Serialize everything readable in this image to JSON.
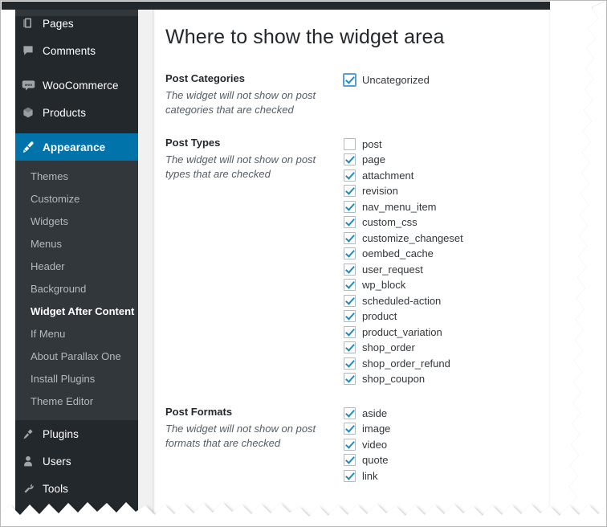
{
  "app": {
    "admin_bar_color": "#23282d",
    "accent_color": "#0073aa",
    "submenu_bg": "#32373c",
    "checkbox_check_color": "#1e8cbe"
  },
  "sidebar": {
    "items": [
      {
        "label": "Pages",
        "icon": "pages-icon",
        "current": false
      },
      {
        "label": "Comments",
        "icon": "comments-icon",
        "current": false
      },
      {
        "label": "WooCommerce",
        "icon": "woocommerce-icon",
        "current": false
      },
      {
        "label": "Products",
        "icon": "products-icon",
        "current": false
      },
      {
        "label": "Appearance",
        "icon": "appearance-brush-icon",
        "current": true
      }
    ],
    "submenu": [
      {
        "label": "Themes",
        "active": false
      },
      {
        "label": "Customize",
        "active": false
      },
      {
        "label": "Widgets",
        "active": false
      },
      {
        "label": "Menus",
        "active": false
      },
      {
        "label": "Header",
        "active": false
      },
      {
        "label": "Background",
        "active": false
      },
      {
        "label": "Widget After Content",
        "active": true
      },
      {
        "label": "If Menu",
        "active": false
      },
      {
        "label": "About Parallax One",
        "active": false
      },
      {
        "label": "Install Plugins",
        "active": false
      },
      {
        "label": "Theme Editor",
        "active": false
      }
    ],
    "lower_items": [
      {
        "label": "Plugins",
        "icon": "plugins-plug-icon"
      },
      {
        "label": "Users",
        "icon": "users-person-icon"
      },
      {
        "label": "Tools",
        "icon": "tools-wrench-icon"
      }
    ]
  },
  "main": {
    "title": "Where to show the widget area",
    "sections": [
      {
        "title": "Post Categories",
        "hint": "The widget will not show on post categories that are checked",
        "options": [
          {
            "label": "Uncategorized",
            "checked": true,
            "focused": true
          }
        ]
      },
      {
        "title": "Post Types",
        "hint": "The widget will not show on post types that are checked",
        "options": [
          {
            "label": "post",
            "checked": false,
            "focused": false
          },
          {
            "label": "page",
            "checked": true,
            "focused": false
          },
          {
            "label": "attachment",
            "checked": true,
            "focused": false
          },
          {
            "label": "revision",
            "checked": true,
            "focused": false
          },
          {
            "label": "nav_menu_item",
            "checked": true,
            "focused": false
          },
          {
            "label": "custom_css",
            "checked": true,
            "focused": false
          },
          {
            "label": "customize_changeset",
            "checked": true,
            "focused": false
          },
          {
            "label": "oembed_cache",
            "checked": true,
            "focused": false
          },
          {
            "label": "user_request",
            "checked": true,
            "focused": false
          },
          {
            "label": "wp_block",
            "checked": true,
            "focused": false
          },
          {
            "label": "scheduled-action",
            "checked": true,
            "focused": false
          },
          {
            "label": "product",
            "checked": true,
            "focused": false
          },
          {
            "label": "product_variation",
            "checked": true,
            "focused": false
          },
          {
            "label": "shop_order",
            "checked": true,
            "focused": false
          },
          {
            "label": "shop_order_refund",
            "checked": true,
            "focused": false
          },
          {
            "label": "shop_coupon",
            "checked": true,
            "focused": false
          }
        ]
      },
      {
        "title": "Post Formats",
        "hint": "The widget will not show on post formats that are checked",
        "options": [
          {
            "label": "aside",
            "checked": true,
            "focused": false
          },
          {
            "label": "image",
            "checked": true,
            "focused": false
          },
          {
            "label": "video",
            "checked": true,
            "focused": false
          },
          {
            "label": "quote",
            "checked": true,
            "focused": false
          },
          {
            "label": "link",
            "checked": true,
            "focused": false
          }
        ]
      }
    ]
  }
}
